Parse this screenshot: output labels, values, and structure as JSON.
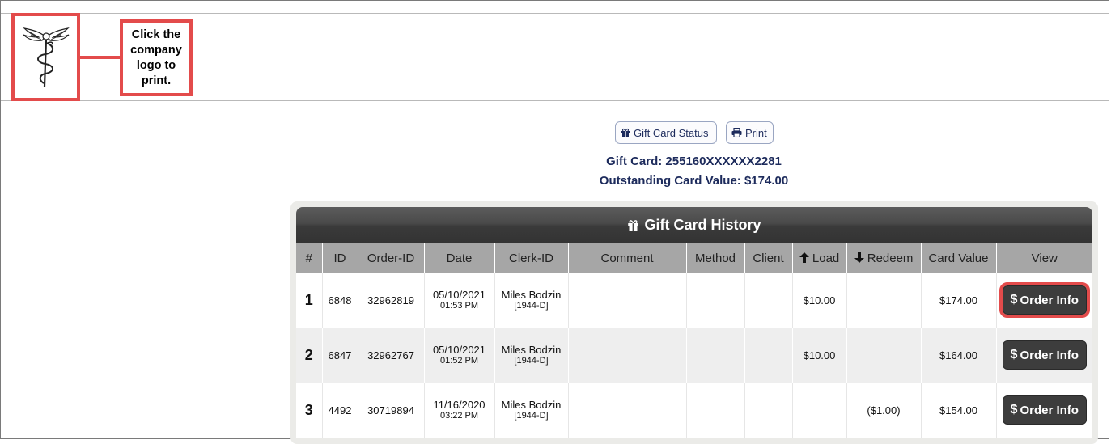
{
  "header": {
    "logo_icon": "caduceus-logo",
    "callout_text": "Click the company logo to print.",
    "highlight_color": "#e34b4b"
  },
  "toolbar": {
    "gift_status_label": "Gift Card Status",
    "print_label": "Print"
  },
  "card": {
    "number_line": "Gift Card: 255160XXXXXX2281",
    "value_line": "Outstanding Card Value: $174.00"
  },
  "history": {
    "title": "Gift Card History",
    "columns": {
      "num": "#",
      "id": "ID",
      "order_id": "Order-ID",
      "date": "Date",
      "clerk_id": "Clerk-ID",
      "comment": "Comment",
      "method": "Method",
      "client": "Client",
      "load": "Load",
      "redeem": "Redeem",
      "card_value": "Card Value",
      "view": "View"
    },
    "rows": [
      {
        "num": "1",
        "id": "6848",
        "order_id": "32962819",
        "date": "05/10/2021",
        "time": "01:53 PM",
        "clerk": "Miles Bodzin",
        "clerk_code": "[1944-D]",
        "comment": "",
        "method": "",
        "client": "",
        "load": "$10.00",
        "redeem": "",
        "card_value": "$174.00",
        "button": "Order Info"
      },
      {
        "num": "2",
        "id": "6847",
        "order_id": "32962767",
        "date": "05/10/2021",
        "time": "01:52 PM",
        "clerk": "Miles Bodzin",
        "clerk_code": "[1944-D]",
        "comment": "",
        "method": "",
        "client": "",
        "load": "$10.00",
        "redeem": "",
        "card_value": "$164.00",
        "button": "Order Info"
      },
      {
        "num": "3",
        "id": "4492",
        "order_id": "30719894",
        "date": "11/16/2020",
        "time": "03:22 PM",
        "clerk": "Miles Bodzin",
        "clerk_code": "[1944-D]",
        "comment": "",
        "method": "",
        "client": "",
        "load": "",
        "redeem": "($1.00)",
        "card_value": "$154.00",
        "button": "Order Info"
      }
    ]
  }
}
